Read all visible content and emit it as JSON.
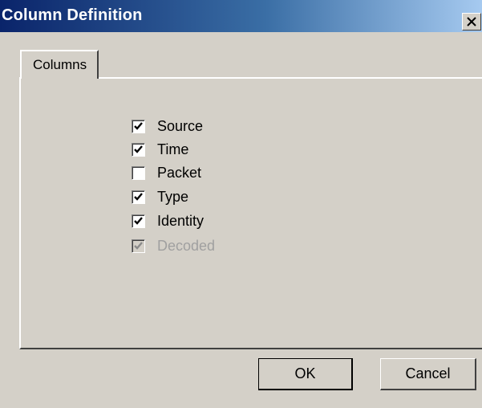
{
  "window": {
    "title": "Column Definition",
    "close_icon": "close-icon"
  },
  "tabs": [
    {
      "label": "Columns",
      "active": true
    }
  ],
  "columns": [
    {
      "label": "Source",
      "checked": true,
      "enabled": true
    },
    {
      "label": "Time",
      "checked": true,
      "enabled": true
    },
    {
      "label": "Packet",
      "checked": false,
      "enabled": true
    },
    {
      "label": "Type",
      "checked": true,
      "enabled": true
    },
    {
      "label": "Identity",
      "checked": true,
      "enabled": true
    },
    {
      "label": "Decoded",
      "checked": true,
      "enabled": false
    }
  ],
  "buttons": {
    "ok_label": "OK",
    "cancel_label": "Cancel"
  },
  "colors": {
    "title_start": "#0a246a",
    "title_end": "#a6caf0",
    "face": "#d4d0c8",
    "disabled_text": "#a0a0a0"
  }
}
